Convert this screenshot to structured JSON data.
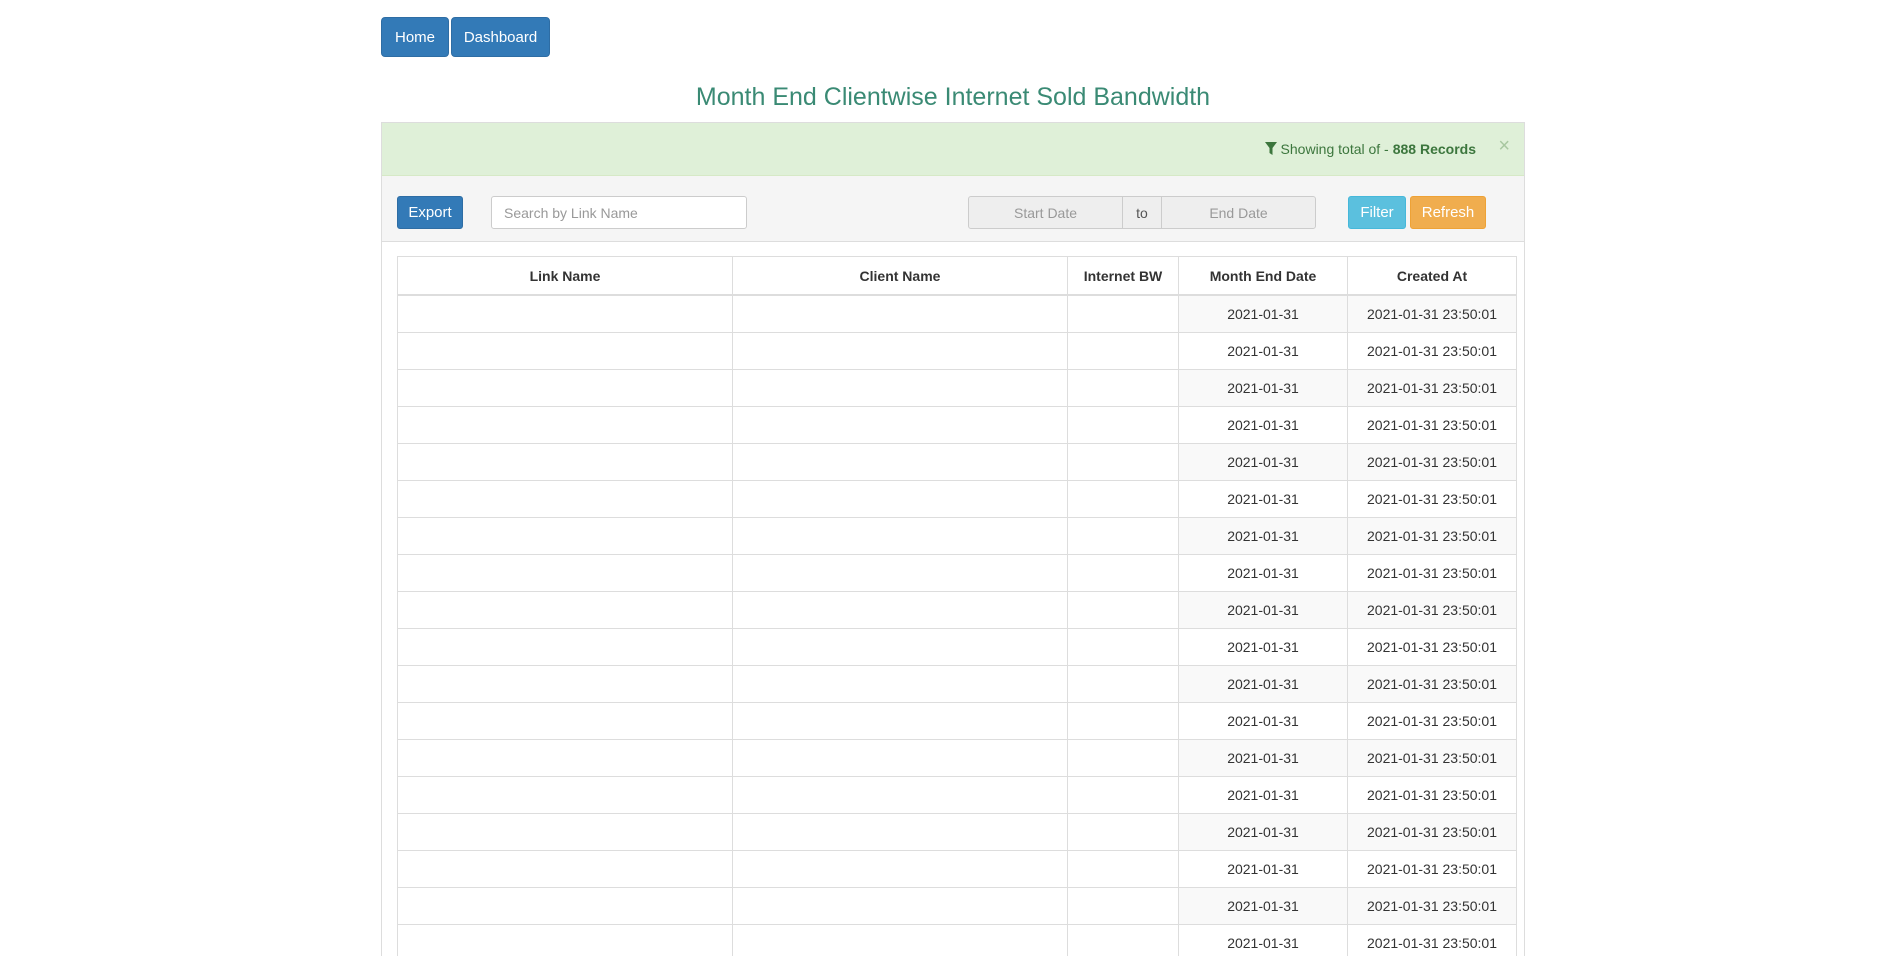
{
  "nav": {
    "home": "Home",
    "dashboard": "Dashboard"
  },
  "title": "Month End Clientwise Internet Sold Bandwidth",
  "alert": {
    "prefix": "Showing total of -",
    "count": "888 Records",
    "close": "×"
  },
  "toolbar": {
    "export": "Export",
    "search_placeholder": "Search by Link Name",
    "start_placeholder": "Start Date",
    "to": "to",
    "end_placeholder": "End Date",
    "filter": "Filter",
    "refresh": "Refresh"
  },
  "table": {
    "columns": [
      "Link Name",
      "Client Name",
      "Internet BW",
      "Month End Date",
      "Created At"
    ],
    "rows": [
      {
        "date": "2021-01-31",
        "created": "2021-01-31 23:50:01"
      },
      {
        "date": "2021-01-31",
        "created": "2021-01-31 23:50:01"
      },
      {
        "date": "2021-01-31",
        "created": "2021-01-31 23:50:01"
      },
      {
        "date": "2021-01-31",
        "created": "2021-01-31 23:50:01"
      },
      {
        "date": "2021-01-31",
        "created": "2021-01-31 23:50:01"
      },
      {
        "date": "2021-01-31",
        "created": "2021-01-31 23:50:01"
      },
      {
        "date": "2021-01-31",
        "created": "2021-01-31 23:50:01"
      },
      {
        "date": "2021-01-31",
        "created": "2021-01-31 23:50:01"
      },
      {
        "date": "2021-01-31",
        "created": "2021-01-31 23:50:01"
      },
      {
        "date": "2021-01-31",
        "created": "2021-01-31 23:50:01"
      },
      {
        "date": "2021-01-31",
        "created": "2021-01-31 23:50:01"
      },
      {
        "date": "2021-01-31",
        "created": "2021-01-31 23:50:01"
      },
      {
        "date": "2021-01-31",
        "created": "2021-01-31 23:50:01"
      },
      {
        "date": "2021-01-31",
        "created": "2021-01-31 23:50:01"
      },
      {
        "date": "2021-01-31",
        "created": "2021-01-31 23:50:01"
      },
      {
        "date": "2021-01-31",
        "created": "2021-01-31 23:50:01"
      },
      {
        "date": "2021-01-31",
        "created": "2021-01-31 23:50:01"
      },
      {
        "date": "2021-01-31",
        "created": "2021-01-31 23:50:01"
      }
    ]
  }
}
